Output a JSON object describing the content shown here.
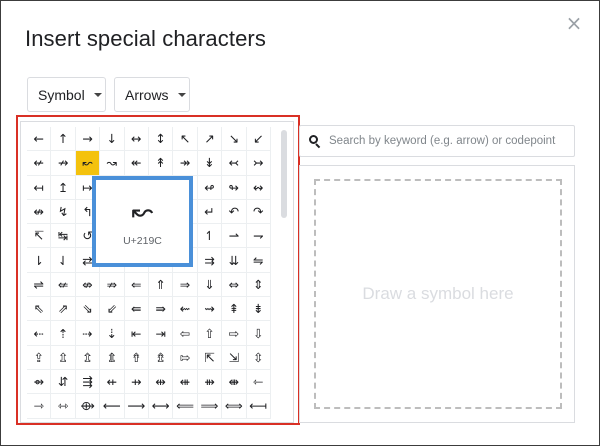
{
  "dialog": {
    "title": "Insert special characters",
    "close_glyph": "×"
  },
  "dropdowns": {
    "category": "Symbol",
    "subcategory": "Arrows"
  },
  "grid": {
    "selected_index": 12,
    "characters": [
      "←",
      "↑",
      "→",
      "↓",
      "↔",
      "↕",
      "↖",
      "↗",
      "↘",
      "↙",
      "↚",
      "↛",
      "↜",
      "↝",
      "↞",
      "↟",
      "↠",
      "↡",
      "↢",
      "↣",
      "↤",
      "↥",
      "↦",
      "↧",
      "↨",
      "↩",
      "↪",
      "↫",
      "↬",
      "↭",
      "↮",
      "↯",
      "↰",
      "↱",
      "↲",
      "↳",
      "↴",
      "↵",
      "↶",
      "↷",
      "↸",
      "↹",
      "↺",
      "↻",
      "↼",
      "↽",
      "↾",
      "↿",
      "⇀",
      "⇁",
      "⇂",
      "⇃",
      "⇄",
      "⇅",
      "⇆",
      "⇇",
      "⇈",
      "⇉",
      "⇊",
      "⇋",
      "⇌",
      "⇍",
      "⇎",
      "⇏",
      "⇐",
      "⇑",
      "⇒",
      "⇓",
      "⇔",
      "⇕",
      "⇖",
      "⇗",
      "⇘",
      "⇙",
      "⇚",
      "⇛",
      "⇜",
      "⇝",
      "⇞",
      "⇟",
      "⇠",
      "⇡",
      "⇢",
      "⇣",
      "⇤",
      "⇥",
      "⇦",
      "⇧",
      "⇨",
      "⇩",
      "⇪",
      "⇫",
      "⇬",
      "⇭",
      "⇮",
      "⇯",
      "⇰",
      "⇱",
      "⇲",
      "⇳",
      "⇴",
      "⇵",
      "⇶",
      "⇷",
      "⇸",
      "⇹",
      "⇺",
      "⇻",
      "⇼",
      "⇽",
      "⇾",
      "⇿",
      "⟴",
      "⟵",
      "⟶",
      "⟷",
      "⟸",
      "⟹",
      "⟺",
      "⟻"
    ]
  },
  "preview": {
    "glyph": "↜",
    "codepoint": "U+219C"
  },
  "search": {
    "placeholder": "Search by keyword (e.g. arrow) or codepoint",
    "value": ""
  },
  "draw": {
    "hint": "Draw a symbol here"
  },
  "colors": {
    "selected_cell": "#f4c20d",
    "preview_border": "#4a90d9",
    "highlight_frame": "#d93025"
  }
}
